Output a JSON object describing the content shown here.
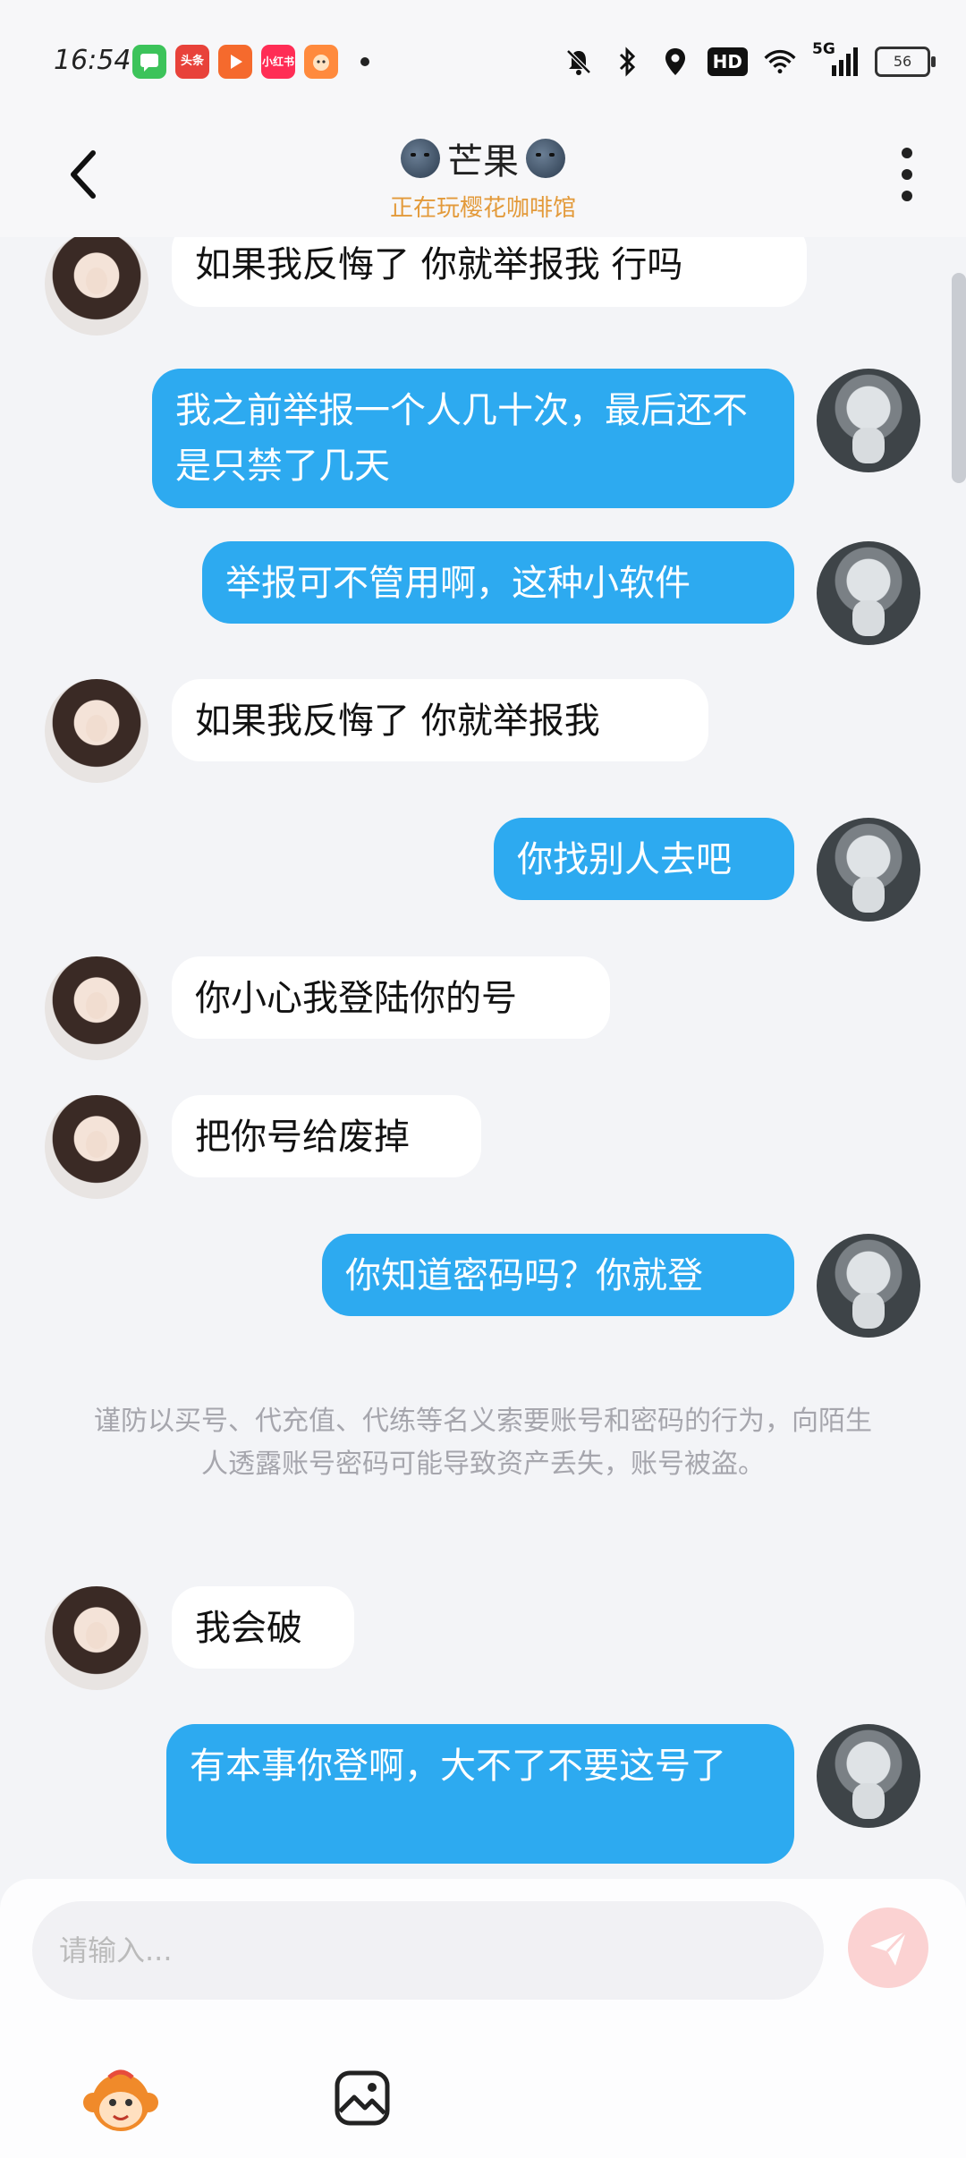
{
  "status_bar": {
    "time": "16:54",
    "apps": [
      {
        "name": "messages-app-icon",
        "label": "",
        "color": "#3cc35a"
      },
      {
        "name": "toutiao-app-icon",
        "label": "头条",
        "color": "#e8423a"
      },
      {
        "name": "video-app-icon",
        "label": "",
        "color": "#f56a2d"
      },
      {
        "name": "xiaohongshu-app-icon",
        "label": "小红书",
        "color": "#ff2d55"
      },
      {
        "name": "game-app-icon",
        "label": "",
        "color": "#ff8a3d"
      }
    ],
    "network": "5G",
    "hd_label": "HD",
    "battery": "56"
  },
  "header": {
    "title": "芒果",
    "subtitle": "正在玩樱花咖啡馆"
  },
  "messages": [
    {
      "side": "in",
      "text": "如果我反悔了 你就举报我 行吗"
    },
    {
      "side": "out",
      "text": "我之前举报一个人几十次，最后还不是只禁了几天"
    },
    {
      "side": "out",
      "text": "举报可不管用啊，这种小软件"
    },
    {
      "side": "in",
      "text": "如果我反悔了 你就举报我"
    },
    {
      "side": "out",
      "text": "你找别人去吧"
    },
    {
      "side": "in",
      "text": "你小心我登陆你的号"
    },
    {
      "side": "in",
      "text": "把你号给废掉"
    },
    {
      "side": "out",
      "text": "你知道密码吗？你就登"
    },
    {
      "side": "in",
      "text": "我会破"
    },
    {
      "side": "out",
      "text": "有本事你登啊，大不了不要这号了"
    }
  ],
  "notice": "谨防以买号、代充值、代练等名义索要账号和密码的行为，向陌生人透露账号密码可能导致资产丢失，账号被盗。",
  "composer": {
    "placeholder": "请输入..."
  },
  "colors": {
    "outgoing_bubble": "#2daaf0",
    "incoming_bubble": "#ffffff",
    "subtitle": "#e39a3a"
  }
}
